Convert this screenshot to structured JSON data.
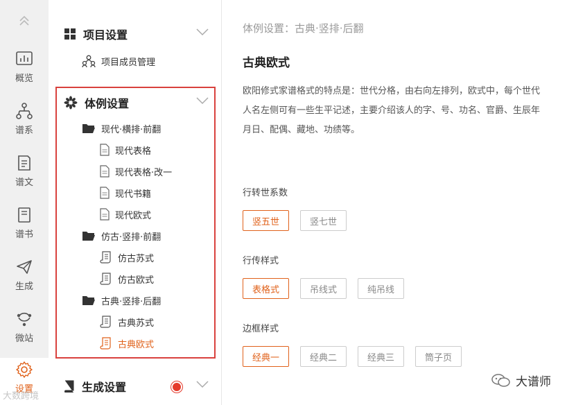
{
  "rail": {
    "items": [
      {
        "label": "概览",
        "icon": "chart-icon"
      },
      {
        "label": "谱系",
        "icon": "tree-network-icon"
      },
      {
        "label": "谱文",
        "icon": "document-icon"
      },
      {
        "label": "谱书",
        "icon": "book-icon"
      },
      {
        "label": "生成",
        "icon": "paper-plane-icon"
      },
      {
        "label": "微站",
        "icon": "microsite-icon"
      },
      {
        "label": "设置",
        "icon": "gear-icon"
      }
    ],
    "active": "设置"
  },
  "tree": {
    "project": {
      "title": "项目设置",
      "children": [
        "项目成员管理"
      ]
    },
    "style": {
      "title": "体例设置",
      "groups": [
        {
          "label": "现代·横排·前翻",
          "items": [
            "现代表格",
            "现代表格·改一",
            "现代书籍",
            "现代欧式"
          ]
        },
        {
          "label": "仿古·竖排·前翻",
          "items": [
            "仿古苏式",
            "仿古欧式"
          ]
        },
        {
          "label": "古典·竖排·后翻",
          "items": [
            "古典苏式",
            "古典欧式"
          ]
        }
      ],
      "selected": "古典欧式"
    },
    "generate": {
      "title": "生成设置"
    }
  },
  "content": {
    "breadcrumb": "体例设置：古典·竖排·后翻",
    "title": "古典欧式",
    "description": "欧阳修式家谱格式的特点是：世代分格，由右向左排列，欧式中，每个世代人名左侧可有一些生平记述，主要介绍该人的字、号、功名、官爵、生辰年月日、配偶、藏地、功绩等。",
    "options": [
      {
        "label": "行转世系数",
        "buttons": [
          "竖五世",
          "竖七世"
        ],
        "selected": "竖五世"
      },
      {
        "label": "行传样式",
        "buttons": [
          "表格式",
          "吊线式",
          "纯吊线"
        ],
        "selected": "表格式"
      },
      {
        "label": "边框样式",
        "buttons": [
          "经典一",
          "经典二",
          "经典三",
          "筒子页"
        ],
        "selected": "经典一"
      }
    ]
  },
  "watermarks": {
    "right": "大谱师",
    "left": "大数跨境"
  },
  "colors": {
    "accent": "#e0611a",
    "highlight_border": "#d9413d",
    "notification": "#e53b2c",
    "rail_bg": "#f0f0f0"
  }
}
